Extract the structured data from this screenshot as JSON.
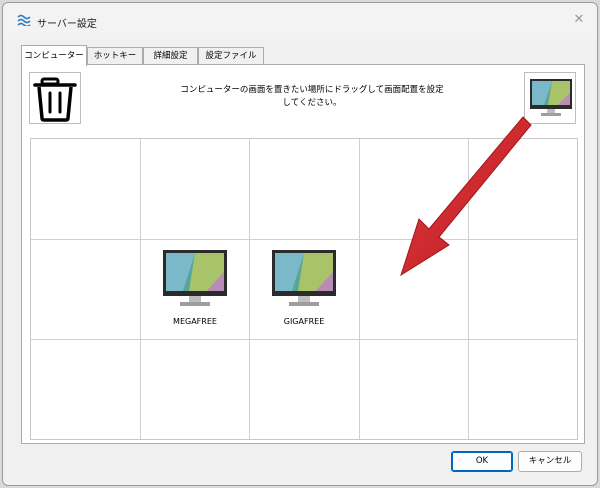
{
  "window": {
    "title": "サーバー設定",
    "close_symbol": "✕"
  },
  "tabs": [
    {
      "label": "コンピューター",
      "active": true
    },
    {
      "label": "ホットキー",
      "active": false
    },
    {
      "label": "詳細設定",
      "active": false
    },
    {
      "label": "設定ファイル",
      "active": false
    }
  ],
  "layout_panel": {
    "instruction_line1": "コンピューターの画面を置きたい場所にドラッグして画面配置を設定",
    "instruction_line2": "してください。",
    "trash_icon": "trash-icon",
    "new_computer_icon": "monitor-icon",
    "grid_rows": 3,
    "grid_cols": 5,
    "computers": [
      {
        "name": "MEGAFREE",
        "row": 2,
        "col": 2
      },
      {
        "name": "GIGAFREE",
        "row": 2,
        "col": 3
      }
    ]
  },
  "annotation": {
    "type": "red-arrow",
    "color": "#d3262b"
  },
  "buttons": {
    "ok": "OK",
    "cancel": "キャンセル"
  },
  "colors": {
    "accent": "#0067c0",
    "grid_line": "#cfcfcf"
  }
}
